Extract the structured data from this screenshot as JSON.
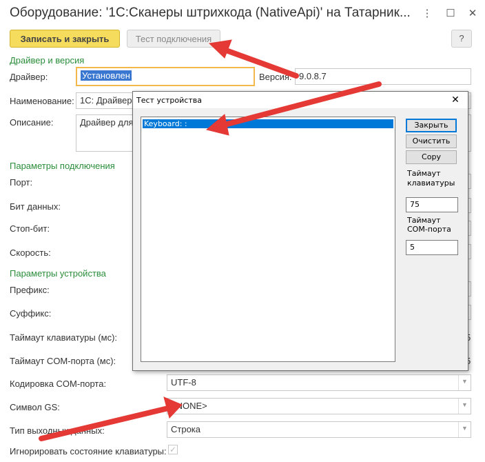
{
  "window": {
    "title": "Оборудование: '1С:Сканеры штрихкода (NativeApi)' на Татарник...",
    "more_icon": "more-vertical-icon",
    "maximize_icon": "maximize-icon",
    "close_icon": "close-icon"
  },
  "toolbar": {
    "save_close": "Записать и закрыть",
    "test_connection": "Тест подключения",
    "help": "?"
  },
  "driver_section": {
    "title": "Драйвер и версия",
    "driver_label": "Драйвер:",
    "driver_value": "Установлен",
    "version_label": "Версия:",
    "version_value": "9.0.8.7",
    "name_label": "Наименование:",
    "name_value": "1С: Драйвер",
    "description_label": "Описание:",
    "description_value": "Драйвер для"
  },
  "connection_section": {
    "title": "Параметры подключения",
    "port_label": "Порт:",
    "data_bits_label": "Бит данных:",
    "stop_bits_label": "Стоп-бит:",
    "speed_label": "Скорость:"
  },
  "device_section": {
    "title": "Параметры устройства",
    "prefix_label": "Префикс:",
    "suffix_label": "Суффикс:",
    "kbd_timeout_label": "Таймаут клавиатуры (мс):",
    "kbd_timeout_partial": "5",
    "com_timeout_label": "Таймаут COM-порта (мс):",
    "com_timeout_partial": "5",
    "com_encoding_label": "Кодировка COM-порта:",
    "com_encoding_value": "UTF-8",
    "gs_label": "Символ GS:",
    "gs_value": "<NONE>",
    "output_type_label": "Тип выходных данных:",
    "output_type_value": "Строка",
    "ignore_kbd_label": "Игнорировать состояние клавиатуры:",
    "ignore_kbd_checked": true
  },
  "dialog": {
    "title": "Тест устройства",
    "list_items": [
      "Keyboard: :"
    ],
    "close_button": "Закрыть",
    "clear_button": "Очистить",
    "copy_button": "Copy",
    "kbd_timeout_label_1": "Таймаут",
    "kbd_timeout_label_2": "клавиатуры",
    "kbd_timeout_value": "75",
    "com_timeout_label_1": "Таймаут",
    "com_timeout_label_2": "COM-порта",
    "com_timeout_value": "5"
  },
  "colors": {
    "accent_yellow": "#f6dc5d",
    "section_green": "#2a8d3a",
    "selection_blue": "#0078d7",
    "annotation_red": "#e53935"
  }
}
